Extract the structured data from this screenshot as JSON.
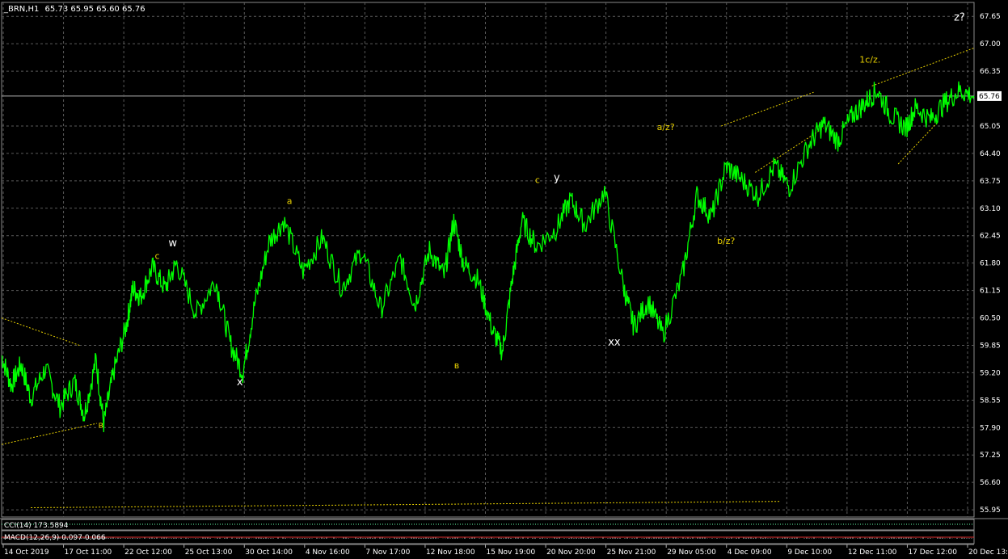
{
  "header": {
    "symbol": "_BRN,H1",
    "ohlc": "65.73 65.95 65.60 65.76"
  },
  "colors": {
    "background": "#000000",
    "price_line": "#00ff00",
    "grid": "#5a5a5a",
    "wave_label_yellow": "#e8d000",
    "wave_label_white": "#ffffff",
    "trend_line": "#e8d000"
  },
  "chart_data": {
    "type": "line",
    "title": "",
    "xlabel": "",
    "ylabel": "",
    "ylim": [
      55.78,
      67.98
    ],
    "grid": true,
    "price_axis_ticks": [
      "67.65",
      "67.00",
      "66.35",
      "65.76",
      "65.05",
      "64.40",
      "63.75",
      "63.10",
      "62.45",
      "61.80",
      "61.15",
      "60.50",
      "59.85",
      "59.20",
      "58.55",
      "57.90",
      "57.25",
      "56.60",
      "55.95"
    ],
    "time_axis_ticks": [
      "14 Oct 2019",
      "17 Oct 11:00",
      "22 Oct 12:00",
      "25 Oct 13:00",
      "30 Oct 14:00",
      "4 Nov 16:00",
      "7 Nov 17:00",
      "12 Nov 18:00",
      "15 Nov 19:00",
      "20 Nov 20:00",
      "25 Nov 21:00",
      "29 Nov 05:00",
      "4 Dec 09:00",
      "9 Dec 10:00",
      "12 Dec 11:00",
      "17 Dec 12:00",
      "20 Dec 13:00"
    ],
    "current_price": "65.76",
    "series": [
      {
        "x": [
          0,
          0.01,
          0.02,
          0.03,
          0.045,
          0.06,
          0.075,
          0.085,
          0.097,
          0.105,
          0.115,
          0.128,
          0.135,
          0.143,
          0.155,
          0.168,
          0.18,
          0.2,
          0.22,
          0.235,
          0.248,
          0.26,
          0.275,
          0.29,
          0.31,
          0.33,
          0.35,
          0.37,
          0.39,
          0.41,
          0.425,
          0.44,
          0.455,
          0.465,
          0.475,
          0.49,
          0.505,
          0.515,
          0.525,
          0.535,
          0.55,
          0.57,
          0.585,
          0.6,
          0.62,
          0.64,
          0.65,
          0.665,
          0.68,
          0.7,
          0.715,
          0.73,
          0.745,
          0.76,
          0.778,
          0.795,
          0.81,
          0.83,
          0.845,
          0.86,
          0.875,
          0.888,
          0.9,
          0.915,
          0.93,
          0.94,
          0.955,
          0.97,
          0.985,
          1.0
        ],
        "values": [
          59.6,
          58.9,
          59.4,
          58.6,
          59.3,
          58.4,
          59.0,
          58.2,
          59.5,
          58.0,
          59.2,
          60.3,
          61.2,
          61.0,
          61.7,
          61.2,
          61.8,
          60.6,
          61.4,
          59.9,
          59.2,
          60.8,
          62.3,
          62.8,
          61.6,
          62.4,
          61.2,
          62.1,
          60.7,
          61.9,
          60.8,
          62.1,
          61.5,
          62.8,
          61.8,
          61.4,
          60.2,
          59.7,
          61.4,
          62.8,
          62.2,
          62.6,
          63.3,
          62.7,
          63.5,
          61.2,
          60.3,
          60.9,
          60.1,
          61.5,
          63.4,
          62.9,
          64.1,
          63.8,
          63.4,
          64.1,
          63.6,
          64.6,
          65.1,
          64.7,
          65.3,
          65.6,
          65.9,
          65.3,
          65.0,
          65.5,
          65.2,
          65.6,
          65.9,
          65.76
        ]
      }
    ],
    "wave_labels": [
      {
        "text": "в",
        "color": "yellow",
        "x": 0.102,
        "price": 57.9
      },
      {
        "text": "c",
        "color": "yellow",
        "x": 0.16,
        "price": 61.9
      },
      {
        "text": "w",
        "color": "white",
        "x": 0.176,
        "price": 62.2
      },
      {
        "text": "x",
        "color": "white",
        "x": 0.245,
        "price": 58.9
      },
      {
        "text": "a",
        "color": "yellow",
        "x": 0.296,
        "price": 63.2
      },
      {
        "text": "в",
        "color": "yellow",
        "x": 0.468,
        "price": 59.3
      },
      {
        "text": "c",
        "color": "yellow",
        "x": 0.551,
        "price": 63.7
      },
      {
        "text": "y",
        "color": "white",
        "x": 0.571,
        "price": 63.75
      },
      {
        "text": "xx",
        "color": "white",
        "x": 0.63,
        "price": 59.85
      },
      {
        "text": "a/z?",
        "color": "yellow",
        "x": 0.683,
        "price": 64.95
      },
      {
        "text": "b/z?",
        "color": "yellow",
        "x": 0.745,
        "price": 62.25
      },
      {
        "text": "1c/z.",
        "color": "yellow",
        "x": 0.893,
        "price": 66.55
      },
      {
        "text": "z?",
        "color": "white",
        "x": 0.985,
        "price": 67.55
      }
    ]
  },
  "indicators": {
    "cci_label": "CCI(14) 173.5894",
    "macd_label": "MACD(12,26,9) 0.097 0.066"
  }
}
